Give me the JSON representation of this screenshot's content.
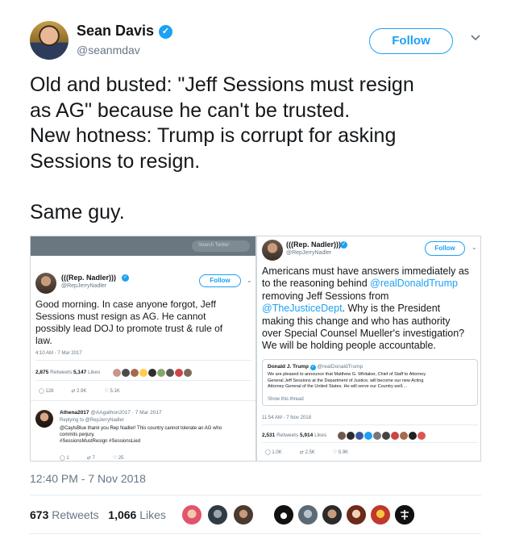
{
  "author": {
    "name": "Sean Davis",
    "handle": "@seanmdav",
    "verified_glyph": "✓",
    "follow_label": "Follow"
  },
  "tweet": {
    "text": "Old and busted: \"Jeff Sessions must resign\nas AG\" because he can't be trusted.\nNew hotness: Trump is corrupt for asking\nSessions to resign.\n\nSame guy.",
    "timestamp": "12:40 PM - 7 Nov 2018",
    "retweets": "673",
    "retweets_label": "Retweets",
    "likes": "1,066",
    "likes_label": "Likes"
  },
  "left_screenshot": {
    "search_placeholder": "Search Twitter",
    "name": "(((Rep. Nadler)))",
    "handle": "@RepJerryNadler",
    "follow_label": "Follow",
    "text": "Good morning.  In case anyone forgot, Jeff\nSessions must resign as AG.  He cannot\npossibly lead DOJ to promote trust & rule of\nlaw.",
    "time": "4:10 AM - 7 Mar 2017",
    "retweets": "2,875",
    "retweets_label": "Retweets",
    "likes": "5,147",
    "likes_label": "Likes",
    "action_reply": "128",
    "action_rt": "2.9K",
    "action_like": "5.1K",
    "reply": {
      "name": "Athena2017",
      "handle": "@AAgathon2017 · 7 Mar 2017",
      "replying_to": "Replying to @RepJerryNadler",
      "text": "@CaylsBlue thank you Rep Nadler! This country cannot tolerate an AG who\ncommits perjury.\n#SessionsMustResign #SessionsLied",
      "action_reply": "1",
      "action_rt": "7",
      "action_like": "25"
    }
  },
  "right_screenshot": {
    "name": "(((Rep. Nadler)))",
    "handle": "@RepJerryNadler",
    "follow_label": "Follow",
    "text_before": "Americans must have answers immediately as\nto the reasoning behind ",
    "mention1": "@realDonaldTrump",
    "text_mid1": "\nremoving Jeff Sessions from\n",
    "mention2": "@TheJusticeDept",
    "text_after": ". Why is the President\nmaking this change and who has authority\nover Special Counsel Mueller's investigation?\nWe will be holding people accountable.",
    "quote": {
      "name": "Donald J. Trump",
      "handle": "@realDonaldTrump",
      "text": "We are pleased to announce that Matthew G. Whitaker, Chief of Staff to Attorney\nGeneral Jeff Sessions at the Department of Justice, will become our new Acting\nAttorney General of the United States. He will serve our Country well....",
      "show_thread": "Show this thread"
    },
    "time": "11:54 AM - 7 Nov 2018",
    "retweets": "2,531",
    "retweets_label": "Retweets",
    "likes": "5,914",
    "likes_label": "Likes",
    "action_reply": "1.0K",
    "action_rt": "2.5K",
    "action_like": "5.9K"
  },
  "colors": {
    "accent": "#1da1f2",
    "text": "#14171a",
    "muted": "#657786"
  }
}
